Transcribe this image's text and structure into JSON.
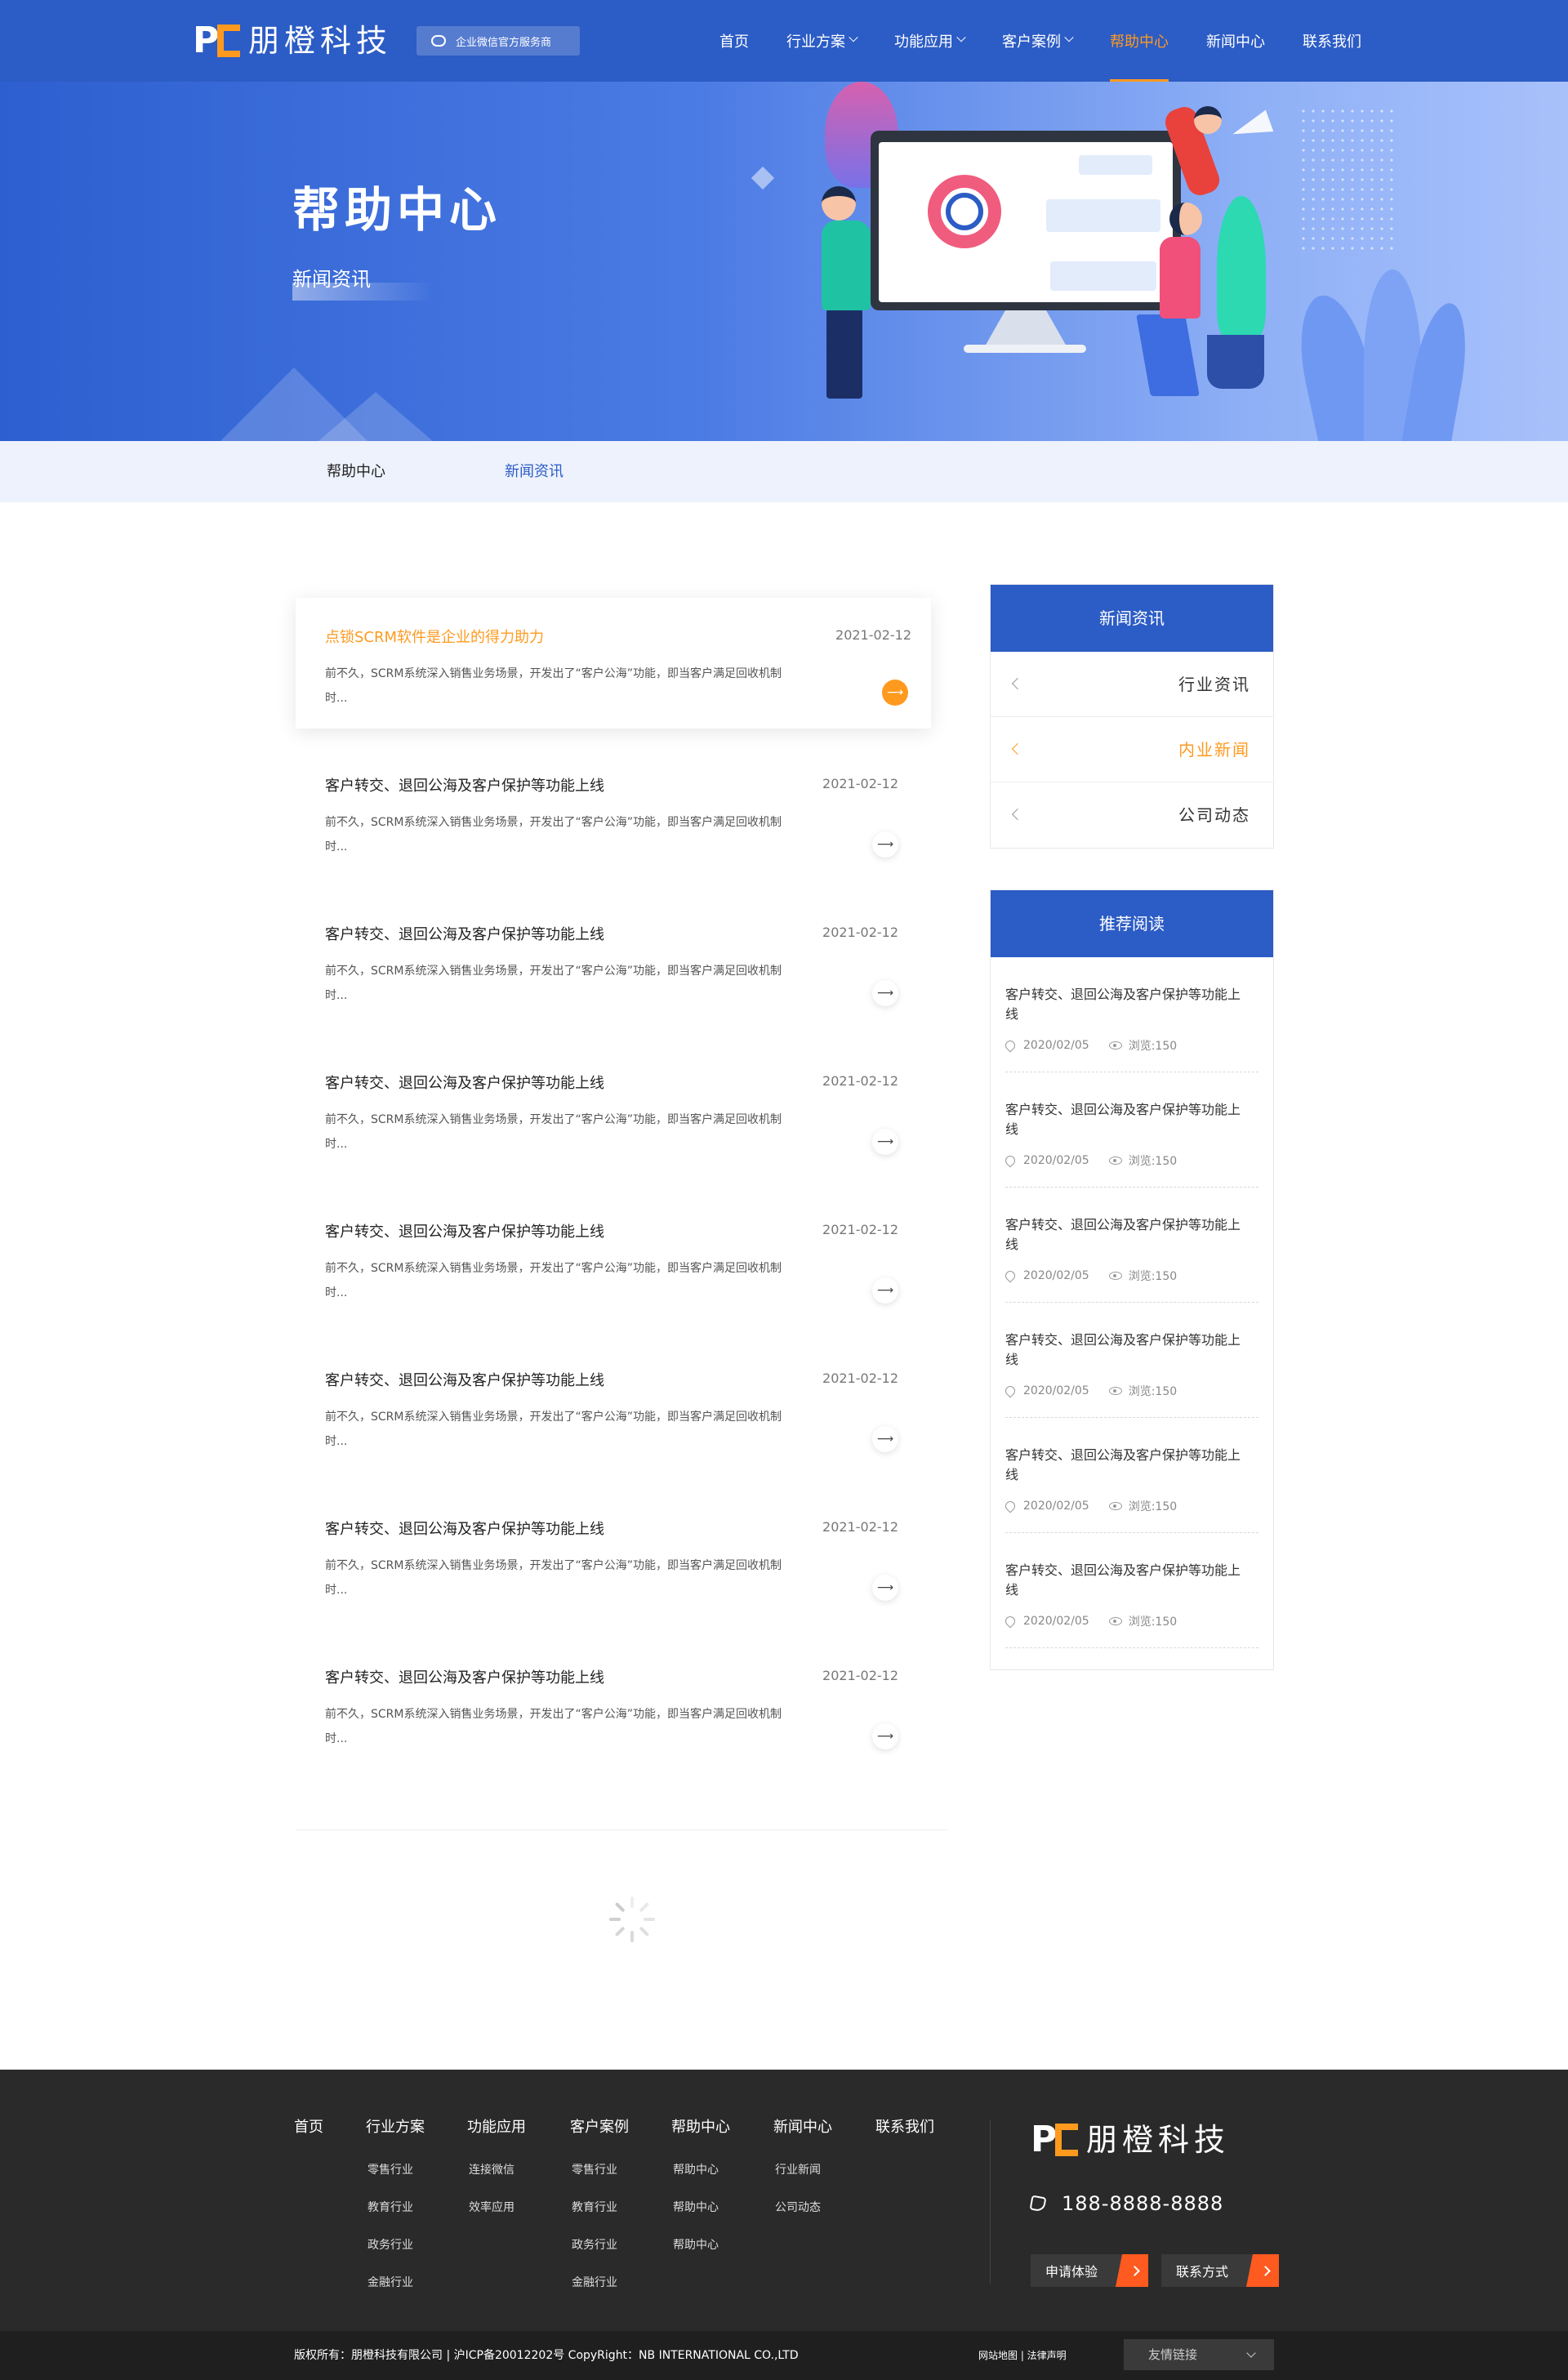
{
  "brand": {
    "logo_text": "朋橙科技",
    "logo_letters": "P",
    "wechat_badge": "企业微信官方服务商"
  },
  "nav": [
    {
      "label": "首页",
      "dropdown": false,
      "active": false
    },
    {
      "label": "行业方案",
      "dropdown": true,
      "active": false
    },
    {
      "label": "功能应用",
      "dropdown": true,
      "active": false
    },
    {
      "label": "客户案例",
      "dropdown": true,
      "active": false
    },
    {
      "label": "帮助中心",
      "dropdown": false,
      "active": true
    },
    {
      "label": "新闻中心",
      "dropdown": false,
      "active": false
    },
    {
      "label": "联系我们",
      "dropdown": false,
      "active": false
    }
  ],
  "banner": {
    "title": "帮助中心",
    "subtitle": "新闻资讯"
  },
  "breadcrumb": {
    "first": "帮助中心",
    "second": "新闻资讯"
  },
  "articles": [
    {
      "title": "点锁SCRM软件是企业的得力助力",
      "date": "2021-02-12",
      "desc": "前不久，SCRM系统深入销售业务场景，开发出了“客户公海”功能，即当客户满足回收机制时...",
      "highlight": true
    },
    {
      "title": "客户转交、退回公海及客户保护等功能上线",
      "date": "2021-02-12",
      "desc": "前不久，SCRM系统深入销售业务场景，开发出了“客户公海”功能，即当客户满足回收机制时...",
      "highlight": false
    },
    {
      "title": "客户转交、退回公海及客户保护等功能上线",
      "date": "2021-02-12",
      "desc": "前不久，SCRM系统深入销售业务场景，开发出了“客户公海”功能，即当客户满足回收机制时...",
      "highlight": false
    },
    {
      "title": "客户转交、退回公海及客户保护等功能上线",
      "date": "2021-02-12",
      "desc": "前不久，SCRM系统深入销售业务场景，开发出了“客户公海”功能，即当客户满足回收机制时...",
      "highlight": false
    },
    {
      "title": "客户转交、退回公海及客户保护等功能上线",
      "date": "2021-02-12",
      "desc": "前不久，SCRM系统深入销售业务场景，开发出了“客户公海”功能，即当客户满足回收机制时...",
      "highlight": false
    },
    {
      "title": "客户转交、退回公海及客户保护等功能上线",
      "date": "2021-02-12",
      "desc": "前不久，SCRM系统深入销售业务场景，开发出了“客户公海”功能，即当客户满足回收机制时...",
      "highlight": false
    },
    {
      "title": "客户转交、退回公海及客户保护等功能上线",
      "date": "2021-02-12",
      "desc": "前不久，SCRM系统深入销售业务场景，开发出了“客户公海”功能，即当客户满足回收机制时...",
      "highlight": false
    },
    {
      "title": "客户转交、退回公海及客户保护等功能上线",
      "date": "2021-02-12",
      "desc": "前不久，SCRM系统深入销售业务场景，开发出了“客户公海”功能，即当客户满足回收机制时...",
      "highlight": false
    }
  ],
  "arrow_glyph": "⟶",
  "sidebar": {
    "news_head": "新闻资讯",
    "categories": [
      {
        "label": "行业资讯",
        "active": false
      },
      {
        "label": "内业新闻",
        "active": true
      },
      {
        "label": "公司动态",
        "active": false
      }
    ],
    "rec_head": "推荐阅读",
    "recommended": [
      {
        "title": "客户转交、退回公海及客户保护等功能上线",
        "date": "2020/02/05",
        "views": "浏览:150"
      },
      {
        "title": "客户转交、退回公海及客户保护等功能上线",
        "date": "2020/02/05",
        "views": "浏览:150"
      },
      {
        "title": "客户转交、退回公海及客户保护等功能上线",
        "date": "2020/02/05",
        "views": "浏览:150"
      },
      {
        "title": "客户转交、退回公海及客户保护等功能上线",
        "date": "2020/02/05",
        "views": "浏览:150"
      },
      {
        "title": "客户转交、退回公海及客户保护等功能上线",
        "date": "2020/02/05",
        "views": "浏览:150"
      },
      {
        "title": "客户转交、退回公海及客户保护等功能上线",
        "date": "2020/02/05",
        "views": "浏览:150"
      }
    ]
  },
  "footer": {
    "columns": [
      {
        "head": "首页",
        "links": []
      },
      {
        "head": "行业方案",
        "links": [
          "零售行业",
          "教育行业",
          "政务行业",
          "金融行业"
        ]
      },
      {
        "head": "功能应用",
        "links": [
          "连接微信",
          "效率应用"
        ]
      },
      {
        "head": "客户案例",
        "links": [
          "零售行业",
          "教育行业",
          "政务行业",
          "金融行业"
        ]
      },
      {
        "head": "帮助中心",
        "links": [
          "帮助中心",
          "帮助中心",
          "帮助中心"
        ]
      },
      {
        "head": "新闻中心",
        "links": [
          "行业新闻",
          "公司动态"
        ]
      },
      {
        "head": "联系我们",
        "links": []
      }
    ],
    "phone": "188-8888-8888",
    "btn_trial": "申请体验",
    "btn_contact": "联系方式",
    "copyright": "版权所有：朋橙科技有限公司 | 沪ICP备20012202号  CopyRight：NB INTERNATIONAL CO.,LTD",
    "bottom_links": "网站地图  |  法律声明",
    "friend_links": "友情链接"
  },
  "colors": {
    "primary": "#2c5cc5",
    "accent": "#ff9a1f",
    "footer_bg": "#2a2a2a"
  }
}
